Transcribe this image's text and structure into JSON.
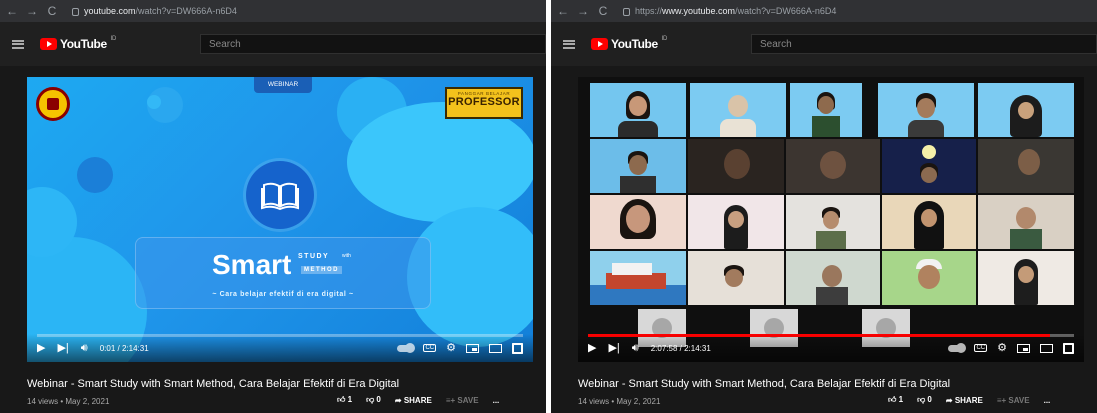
{
  "left": {
    "url_host": "youtube.com",
    "url_path": "/watch?v=DW666A-n6D4",
    "logo_text": "YouTube",
    "region": "ID",
    "search_placeholder": "Search",
    "webinar_tag": "WEBINAR",
    "prof_top": "PANGGAR BELAJAR",
    "prof_main": "PROFESSOR",
    "smart_word": "Smart",
    "study_word": "STUDY",
    "with_word": "with",
    "method_word": "METHOD",
    "tagline": "~ Cara belajar efektif di era digital ~",
    "time": "0:01 / 2:14:31",
    "progress": 0.0001,
    "title": "Webinar - Smart Study with Smart Method, Cara Belajar Efektif di Era Digital",
    "meta": "14 views • May 2, 2021",
    "likes": "1",
    "dislikes": "0",
    "share": "SHARE",
    "save": "SAVE",
    "more": "..."
  },
  "right": {
    "url_scheme": "https://",
    "url_host": "www.youtube.com",
    "url_path": "/watch?v=DW666A-n6D4",
    "logo_text": "YouTube",
    "region": "ID",
    "search_placeholder": "Search",
    "time": "2:07:58 / 2:14:31",
    "progress": 0.9512,
    "title": "Webinar - Smart Study with Smart Method, Cara Belajar Efektif di Era Digital",
    "meta": "14 views • May 2, 2021",
    "likes": "1",
    "dislikes": "0",
    "share": "SHARE",
    "save": "SAVE",
    "more": "..."
  },
  "colors": {
    "accent": "#ff0000",
    "bg": "#181818",
    "slide_blue": "#1ea9f1"
  },
  "icons": [
    "back-icon",
    "forward-icon",
    "reload-icon",
    "lock-icon",
    "menu-icon",
    "youtube-logo-icon",
    "play-icon",
    "next-icon",
    "volume-icon",
    "autoplay-toggle-icon",
    "captions-icon",
    "settings-icon",
    "miniplayer-icon",
    "theater-icon",
    "fullscreen-icon",
    "like-icon",
    "dislike-icon",
    "share-icon",
    "save-icon",
    "more-icon",
    "book-icon"
  ]
}
